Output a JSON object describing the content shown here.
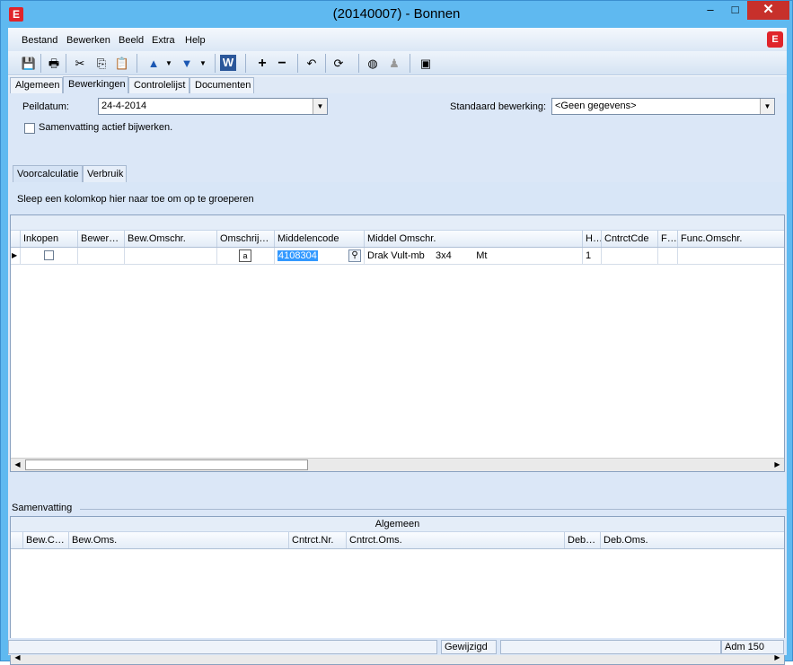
{
  "window": {
    "title": "(20140007) - Bonnen",
    "app_icon": "E",
    "minimize": "–",
    "maximize": "□",
    "close": "✕"
  },
  "menu": {
    "items": [
      "Bestand",
      "Bewerken",
      "Beeld",
      "Extra",
      "Help"
    ],
    "brand_icon": "E"
  },
  "toolbar": {
    "icons": [
      "save-icon",
      "print-icon",
      "cut-icon",
      "copy-icon",
      "paste-icon",
      "move-up-icon",
      "move-down-icon",
      "word-icon",
      "add-icon",
      "remove-icon",
      "undo-icon",
      "refresh-icon",
      "globe-person-icon",
      "person-icon",
      "window-icon"
    ]
  },
  "tabs": [
    "Algemeen",
    "Bewerkingen",
    "Controlelijst",
    "Documenten"
  ],
  "form": {
    "peildatum_label": "Peildatum:",
    "peildatum_value": "24-4-2014",
    "standaard_label": "Standaard bewerking:",
    "standaard_value": "<Geen gegevens>",
    "samenvatting_checkbox_label": "Samenvatting actief bijwerken."
  },
  "subtabs": [
    "Voorcalculatie",
    "Verbruik"
  ],
  "group_hint": "Sleep een kolomkop hier naar toe om op te groeperen",
  "grid": {
    "columns": [
      "Inkopen",
      "Bewer…",
      "Bew.Omschr.",
      "Omschrij…",
      "Middelencode",
      "Middel Omschr.",
      "H…",
      "CntrctCde",
      "F…",
      "Func.Omschr."
    ],
    "rows": [
      {
        "inkopen": "",
        "bewer": "",
        "bew_omschr": "",
        "omschrij": "a",
        "middelencode": "4108304",
        "middel_omschr": "Drak Vult-mb    3x4         Mt",
        "h": "1",
        "cntrctcde": "",
        "f": "",
        "func_omschr": ""
      }
    ]
  },
  "samenvatting": {
    "title": "Samenvatting",
    "band": "Algemeen",
    "columns": [
      "Bew.C…",
      "Bew.Oms.",
      "Cntrct.Nr.",
      "Cntrct.Oms.",
      "Deb…",
      "Deb.Oms."
    ]
  },
  "status": {
    "state": "Gewijzigd",
    "admin": "Adm 150"
  }
}
